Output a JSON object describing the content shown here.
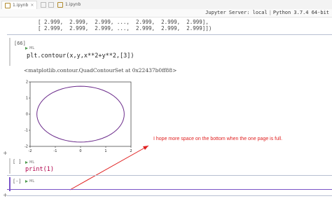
{
  "tabs": [
    {
      "label": "1.ipynb",
      "active": true
    },
    {
      "label": "1.ipynb",
      "active": false
    }
  ],
  "kernel": {
    "server": "Jupyter Server: local",
    "python": "Python 3.7.4 64-bit"
  },
  "array_output": {
    "line1": "[ 2.999,  2.999,  2.999, ...,  2.999,  2.999,  2.999],",
    "line2": "[ 2.999,  2.999,  2.999, ...,  2.999,  2.999,  2.999]])"
  },
  "cells": [
    {
      "prompt": "[66]",
      "run_label": "ML",
      "code_prefix": "plt.contour(x,y,x**2+y**2,[3])",
      "output_text": "<matplotlib.contour.QuadContourSet at 0x22437b0ff88>"
    },
    {
      "prompt": "[ ]",
      "run_label": "ML",
      "code": "print(1)"
    },
    {
      "prompt": "[-]",
      "run_label": "ML"
    }
  ],
  "annotation": "I hope more space  on the bottom when the one page is full.",
  "chart_data": {
    "type": "line",
    "title": "",
    "xlabel": "",
    "ylabel": "",
    "xticks": [
      "-2",
      "-1",
      "0",
      "1",
      "2"
    ],
    "yticks": [
      "-2",
      "-1",
      "0",
      "1",
      "2"
    ],
    "xlim": [
      -2,
      2
    ],
    "ylim": [
      -2,
      2
    ],
    "series": [
      {
        "equation": "x**2+y**2",
        "level": 3,
        "color": "#6a2a8a"
      }
    ]
  }
}
